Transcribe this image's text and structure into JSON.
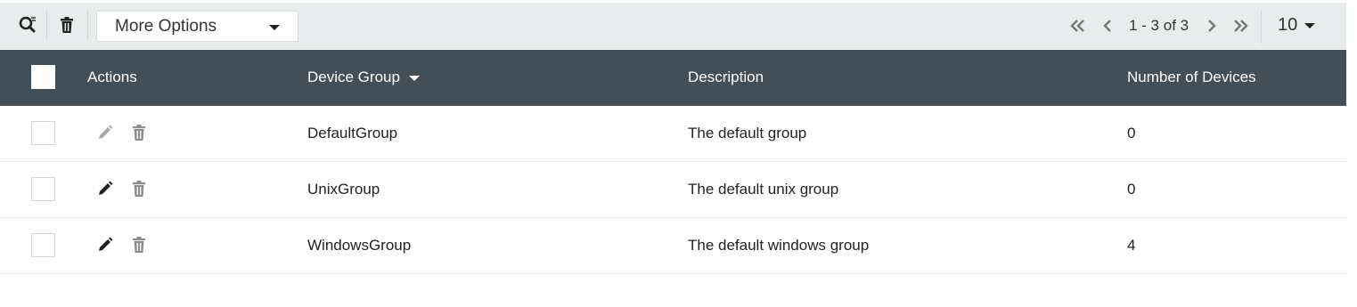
{
  "toolbar": {
    "more_options_label": "More Options",
    "search_icon": "search-filter-icon",
    "delete_icon": "trash-icon"
  },
  "pagination": {
    "range_text": "1 - 3 of 3",
    "page_size": "10"
  },
  "table": {
    "columns": {
      "actions": "Actions",
      "device_group": "Device Group",
      "description": "Description",
      "num_devices": "Number of Devices"
    },
    "rows": [
      {
        "device_group": "DefaultGroup",
        "description": "The default group",
        "num_devices": "0",
        "editable": false
      },
      {
        "device_group": "UnixGroup",
        "description": "The default unix group",
        "num_devices": "0",
        "editable": true
      },
      {
        "device_group": "WindowsGroup",
        "description": "The default windows group",
        "num_devices": "4",
        "editable": true
      }
    ]
  },
  "colors": {
    "header_bg": "#434f58",
    "toolbar_bg": "#e8ecec",
    "icon_dark": "#222222",
    "icon_muted": "#9a9a9a"
  }
}
